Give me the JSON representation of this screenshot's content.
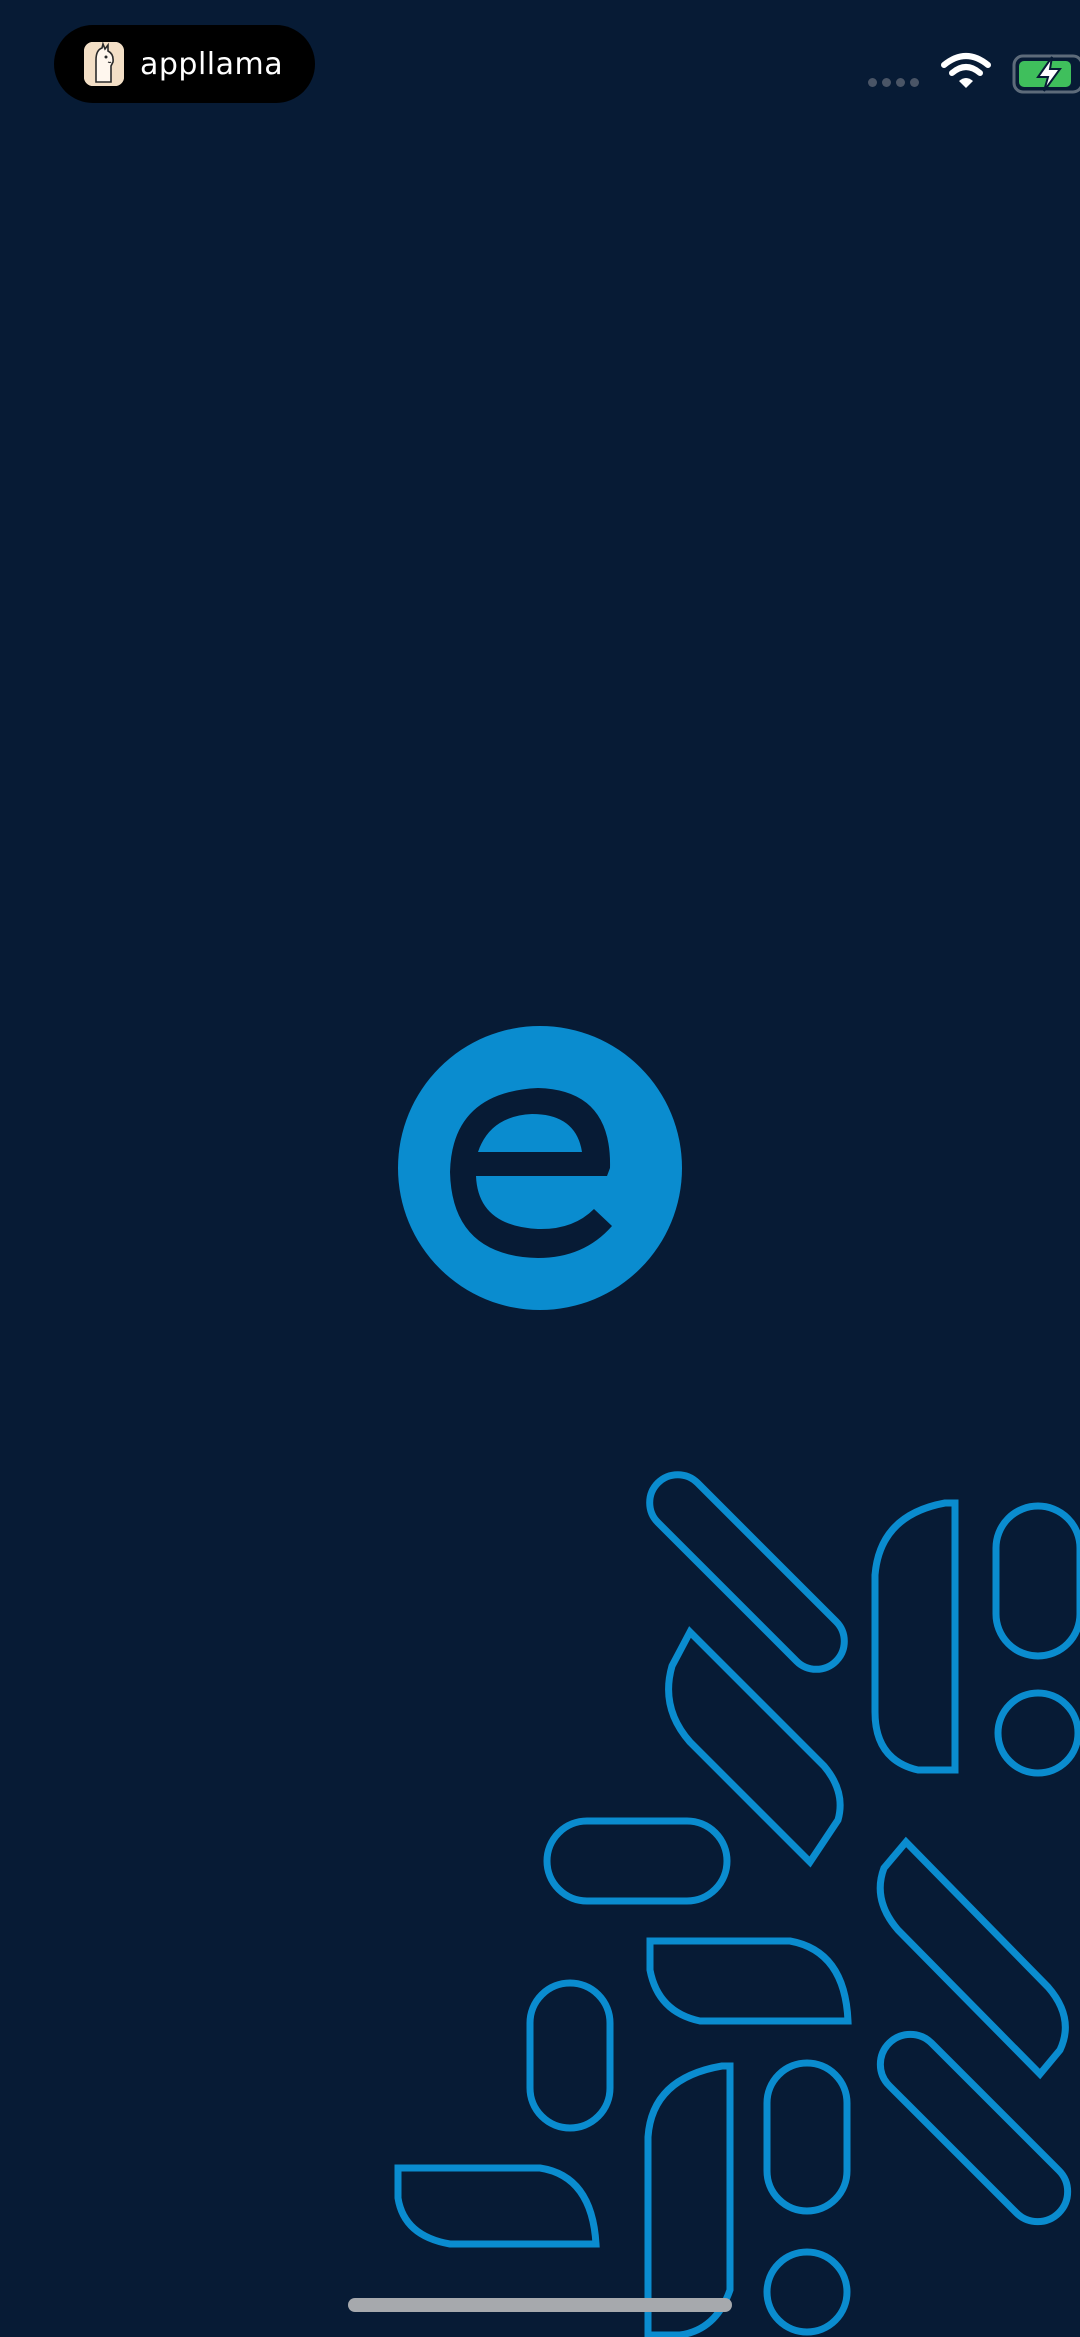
{
  "status_bar": {
    "app_name": "appllama",
    "icons": [
      "appllama-logo-icon",
      "cellular-signal-icon",
      "wifi-icon",
      "battery-charging-icon"
    ]
  },
  "splash": {
    "logo_icon": "e-logo-icon"
  },
  "colors": {
    "background": "#071b35",
    "accent": "#0a8ccf",
    "logo_letter": "#071b35",
    "battery_fill": "#3fbf5c"
  }
}
